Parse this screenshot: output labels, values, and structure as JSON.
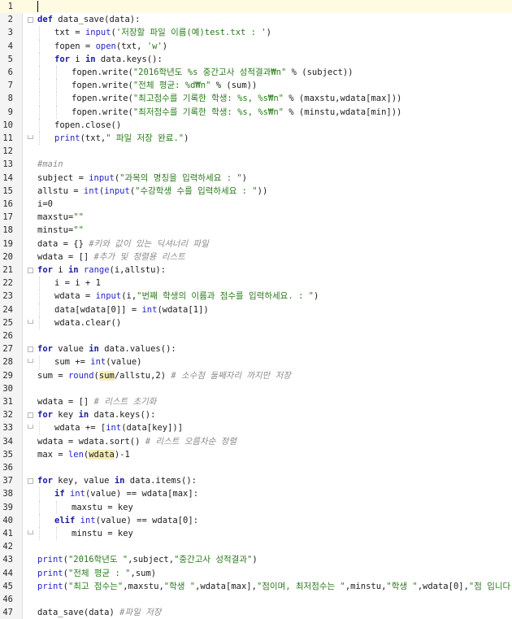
{
  "editor": {
    "current_line": 1,
    "lines": [
      {
        "n": 1,
        "indent": 0,
        "tokens": []
      },
      {
        "n": 2,
        "indent": 0,
        "fold": "start",
        "tokens": [
          {
            "t": "kw",
            "v": "def"
          },
          {
            "t": "p",
            "v": " data_save(data):"
          }
        ]
      },
      {
        "n": 3,
        "indent": 1,
        "tokens": [
          {
            "t": "p",
            "v": "txt = "
          },
          {
            "t": "bi",
            "v": "input"
          },
          {
            "t": "p",
            "v": "("
          },
          {
            "t": "str",
            "v": "'저장할 파일 이름(예)test.txt : '"
          },
          {
            "t": "p",
            "v": ")"
          }
        ]
      },
      {
        "n": 4,
        "indent": 1,
        "tokens": [
          {
            "t": "p",
            "v": "fopen = "
          },
          {
            "t": "bi",
            "v": "open"
          },
          {
            "t": "p",
            "v": "(txt, "
          },
          {
            "t": "str",
            "v": "'w'"
          },
          {
            "t": "p",
            "v": ")"
          }
        ]
      },
      {
        "n": 5,
        "indent": 1,
        "tokens": [
          {
            "t": "kw",
            "v": "for"
          },
          {
            "t": "p",
            "v": " i "
          },
          {
            "t": "kw",
            "v": "in"
          },
          {
            "t": "p",
            "v": " data.keys():"
          }
        ]
      },
      {
        "n": 6,
        "indent": 2,
        "tokens": [
          {
            "t": "p",
            "v": "fopen.write("
          },
          {
            "t": "str",
            "v": "\"2016학년도 %s 중간고사 성적결과₩n\""
          },
          {
            "t": "p",
            "v": " % (subject))"
          }
        ]
      },
      {
        "n": 7,
        "indent": 2,
        "tokens": [
          {
            "t": "p",
            "v": "fopen.write("
          },
          {
            "t": "str",
            "v": "\"전체 평균: %d₩n\""
          },
          {
            "t": "p",
            "v": " % (sum))"
          }
        ]
      },
      {
        "n": 8,
        "indent": 2,
        "tokens": [
          {
            "t": "p",
            "v": "fopen.write("
          },
          {
            "t": "str",
            "v": "\"최고점수를 기록한 학생: %s, %s₩n\""
          },
          {
            "t": "p",
            "v": " % (maxstu,wdata[max]))"
          }
        ]
      },
      {
        "n": 9,
        "indent": 2,
        "tokens": [
          {
            "t": "p",
            "v": "fopen.write("
          },
          {
            "t": "str",
            "v": "\"최저점수를 기록한 학생: %s, %s₩n\""
          },
          {
            "t": "p",
            "v": " % (minstu,wdata[min]))"
          }
        ]
      },
      {
        "n": 10,
        "indent": 1,
        "tokens": [
          {
            "t": "p",
            "v": "fopen.close()"
          }
        ]
      },
      {
        "n": 11,
        "indent": 1,
        "fold": "end",
        "tokens": [
          {
            "t": "bi",
            "v": "print"
          },
          {
            "t": "p",
            "v": "(txt,"
          },
          {
            "t": "str",
            "v": "\" 파일 저장 완료.\""
          },
          {
            "t": "p",
            "v": ")"
          }
        ]
      },
      {
        "n": 12,
        "indent": 0,
        "tokens": []
      },
      {
        "n": 13,
        "indent": 0,
        "tokens": [
          {
            "t": "cmt",
            "v": "#main"
          }
        ]
      },
      {
        "n": 14,
        "indent": 0,
        "tokens": [
          {
            "t": "p",
            "v": "subject = "
          },
          {
            "t": "bi",
            "v": "input"
          },
          {
            "t": "p",
            "v": "("
          },
          {
            "t": "str",
            "v": "\"과목의 명칭을 입력하세요 : \""
          },
          {
            "t": "p",
            "v": ")"
          }
        ]
      },
      {
        "n": 15,
        "indent": 0,
        "tokens": [
          {
            "t": "p",
            "v": "allstu = "
          },
          {
            "t": "bi",
            "v": "int"
          },
          {
            "t": "p",
            "v": "("
          },
          {
            "t": "bi",
            "v": "input"
          },
          {
            "t": "p",
            "v": "("
          },
          {
            "t": "str",
            "v": "\"수강학생 수를 입력하세요 : \""
          },
          {
            "t": "p",
            "v": "))"
          }
        ]
      },
      {
        "n": 16,
        "indent": 0,
        "tokens": [
          {
            "t": "p",
            "v": "i=0"
          }
        ]
      },
      {
        "n": 17,
        "indent": 0,
        "tokens": [
          {
            "t": "p",
            "v": "maxstu="
          },
          {
            "t": "str",
            "v": "\"\""
          }
        ]
      },
      {
        "n": 18,
        "indent": 0,
        "tokens": [
          {
            "t": "p",
            "v": "minstu="
          },
          {
            "t": "str",
            "v": "\"\""
          }
        ]
      },
      {
        "n": 19,
        "indent": 0,
        "tokens": [
          {
            "t": "p",
            "v": "data = {} "
          },
          {
            "t": "cmt",
            "v": "#키와 값이 있는 딕셔너리 파일"
          }
        ]
      },
      {
        "n": 20,
        "indent": 0,
        "tokens": [
          {
            "t": "p",
            "v": "wdata = [] "
          },
          {
            "t": "cmt",
            "v": "#추가 및 정렬용 리스트"
          }
        ]
      },
      {
        "n": 21,
        "indent": 0,
        "fold": "start",
        "tokens": [
          {
            "t": "kw",
            "v": "for"
          },
          {
            "t": "p",
            "v": " i "
          },
          {
            "t": "kw",
            "v": "in"
          },
          {
            "t": "p",
            "v": " "
          },
          {
            "t": "bi",
            "v": "range"
          },
          {
            "t": "p",
            "v": "(i,allstu):"
          }
        ]
      },
      {
        "n": 22,
        "indent": 1,
        "tokens": [
          {
            "t": "p",
            "v": "i = i + 1"
          }
        ]
      },
      {
        "n": 23,
        "indent": 1,
        "tokens": [
          {
            "t": "p",
            "v": "wdata = "
          },
          {
            "t": "bi",
            "v": "input"
          },
          {
            "t": "p",
            "v": "(i,"
          },
          {
            "t": "str",
            "v": "\"번째 학생의 이름과 점수를 입력하세요. : \""
          },
          {
            "t": "p",
            "v": ")"
          }
        ]
      },
      {
        "n": 24,
        "indent": 1,
        "tokens": [
          {
            "t": "p",
            "v": "data[wdata[0]] = "
          },
          {
            "t": "bi",
            "v": "int"
          },
          {
            "t": "p",
            "v": "(wdata[1])"
          }
        ]
      },
      {
        "n": 25,
        "indent": 1,
        "fold": "end",
        "tokens": [
          {
            "t": "p",
            "v": "wdata.clear()"
          }
        ]
      },
      {
        "n": 26,
        "indent": 0,
        "tokens": []
      },
      {
        "n": 27,
        "indent": 0,
        "fold": "start",
        "tokens": [
          {
            "t": "kw",
            "v": "for"
          },
          {
            "t": "p",
            "v": " value "
          },
          {
            "t": "kw",
            "v": "in"
          },
          {
            "t": "p",
            "v": " data.values():"
          }
        ]
      },
      {
        "n": 28,
        "indent": 1,
        "fold": "end",
        "tokens": [
          {
            "t": "p",
            "v": "sum += "
          },
          {
            "t": "bi",
            "v": "int"
          },
          {
            "t": "p",
            "v": "(value)"
          }
        ]
      },
      {
        "n": 29,
        "indent": 0,
        "tokens": [
          {
            "t": "p",
            "v": "sum = "
          },
          {
            "t": "bi",
            "v": "round"
          },
          {
            "t": "p",
            "v": "("
          },
          {
            "t": "hl",
            "v": "sum"
          },
          {
            "t": "p",
            "v": "/allstu,2) "
          },
          {
            "t": "cmt",
            "v": "# 소수점 둘째자리 까지만 저장"
          }
        ]
      },
      {
        "n": 30,
        "indent": 0,
        "tokens": []
      },
      {
        "n": 31,
        "indent": 0,
        "tokens": [
          {
            "t": "p",
            "v": "wdata = [] "
          },
          {
            "t": "cmt",
            "v": "# 리스트 초기화"
          }
        ]
      },
      {
        "n": 32,
        "indent": 0,
        "fold": "start",
        "tokens": [
          {
            "t": "kw",
            "v": "for"
          },
          {
            "t": "p",
            "v": " key "
          },
          {
            "t": "kw",
            "v": "in"
          },
          {
            "t": "p",
            "v": " data.keys():"
          }
        ]
      },
      {
        "n": 33,
        "indent": 1,
        "fold": "end",
        "tokens": [
          {
            "t": "p",
            "v": "wdata += ["
          },
          {
            "t": "bi",
            "v": "int"
          },
          {
            "t": "p",
            "v": "(data[key])]"
          }
        ]
      },
      {
        "n": 34,
        "indent": 0,
        "tokens": [
          {
            "t": "p",
            "v": "wdata = wdata.sort() "
          },
          {
            "t": "cmt",
            "v": "# 리스트 오름차순 정렬"
          }
        ]
      },
      {
        "n": 35,
        "indent": 0,
        "tokens": [
          {
            "t": "p",
            "v": "max = "
          },
          {
            "t": "bi",
            "v": "len"
          },
          {
            "t": "p",
            "v": "("
          },
          {
            "t": "hl",
            "v": "wdata"
          },
          {
            "t": "p",
            "v": ")-1"
          }
        ]
      },
      {
        "n": 36,
        "indent": 0,
        "tokens": []
      },
      {
        "n": 37,
        "indent": 0,
        "fold": "start",
        "tokens": [
          {
            "t": "kw",
            "v": "for"
          },
          {
            "t": "p",
            "v": " key, value "
          },
          {
            "t": "kw",
            "v": "in"
          },
          {
            "t": "p",
            "v": " data.items():"
          }
        ]
      },
      {
        "n": 38,
        "indent": 1,
        "tokens": [
          {
            "t": "kw",
            "v": "if"
          },
          {
            "t": "p",
            "v": " "
          },
          {
            "t": "bi",
            "v": "int"
          },
          {
            "t": "p",
            "v": "(value) == wdata[max]:"
          }
        ]
      },
      {
        "n": 39,
        "indent": 2,
        "tokens": [
          {
            "t": "p",
            "v": "maxstu = key"
          }
        ]
      },
      {
        "n": 40,
        "indent": 1,
        "tokens": [
          {
            "t": "kw",
            "v": "elif"
          },
          {
            "t": "p",
            "v": " "
          },
          {
            "t": "bi",
            "v": "int"
          },
          {
            "t": "p",
            "v": "(value) == wdata[0]:"
          }
        ]
      },
      {
        "n": 41,
        "indent": 2,
        "fold": "end",
        "tokens": [
          {
            "t": "p",
            "v": "minstu = key"
          }
        ]
      },
      {
        "n": 42,
        "indent": 0,
        "tokens": []
      },
      {
        "n": 43,
        "indent": 0,
        "tokens": [
          {
            "t": "bi",
            "v": "print"
          },
          {
            "t": "p",
            "v": "("
          },
          {
            "t": "str",
            "v": "\"2016학년도 \""
          },
          {
            "t": "p",
            "v": ",subject,"
          },
          {
            "t": "str",
            "v": "\"중간고사 성적결과\""
          },
          {
            "t": "p",
            "v": ")"
          }
        ]
      },
      {
        "n": 44,
        "indent": 0,
        "tokens": [
          {
            "t": "bi",
            "v": "print"
          },
          {
            "t": "p",
            "v": "("
          },
          {
            "t": "str",
            "v": "\"전체 평균 : \""
          },
          {
            "t": "p",
            "v": ",sum)"
          }
        ]
      },
      {
        "n": 45,
        "indent": 0,
        "tokens": [
          {
            "t": "bi",
            "v": "print"
          },
          {
            "t": "p",
            "v": "("
          },
          {
            "t": "str",
            "v": "\"최고 점수는\""
          },
          {
            "t": "p",
            "v": ",maxstu,"
          },
          {
            "t": "str",
            "v": "\"학생 \""
          },
          {
            "t": "p",
            "v": ",wdata[max],"
          },
          {
            "t": "str",
            "v": "\"점이며, 최저점수는 \""
          },
          {
            "t": "p",
            "v": ",minstu,"
          },
          {
            "t": "str",
            "v": "\"학생 \""
          },
          {
            "t": "p",
            "v": ",wdata[0],"
          },
          {
            "t": "str",
            "v": "\"점 입니다.\""
          },
          {
            "t": "p",
            "v": ")"
          }
        ]
      },
      {
        "n": 46,
        "indent": 0,
        "tokens": []
      },
      {
        "n": 47,
        "indent": 0,
        "tokens": [
          {
            "t": "p",
            "v": "data_save(data) "
          },
          {
            "t": "cmt",
            "v": "#파일 저장"
          }
        ]
      }
    ]
  }
}
